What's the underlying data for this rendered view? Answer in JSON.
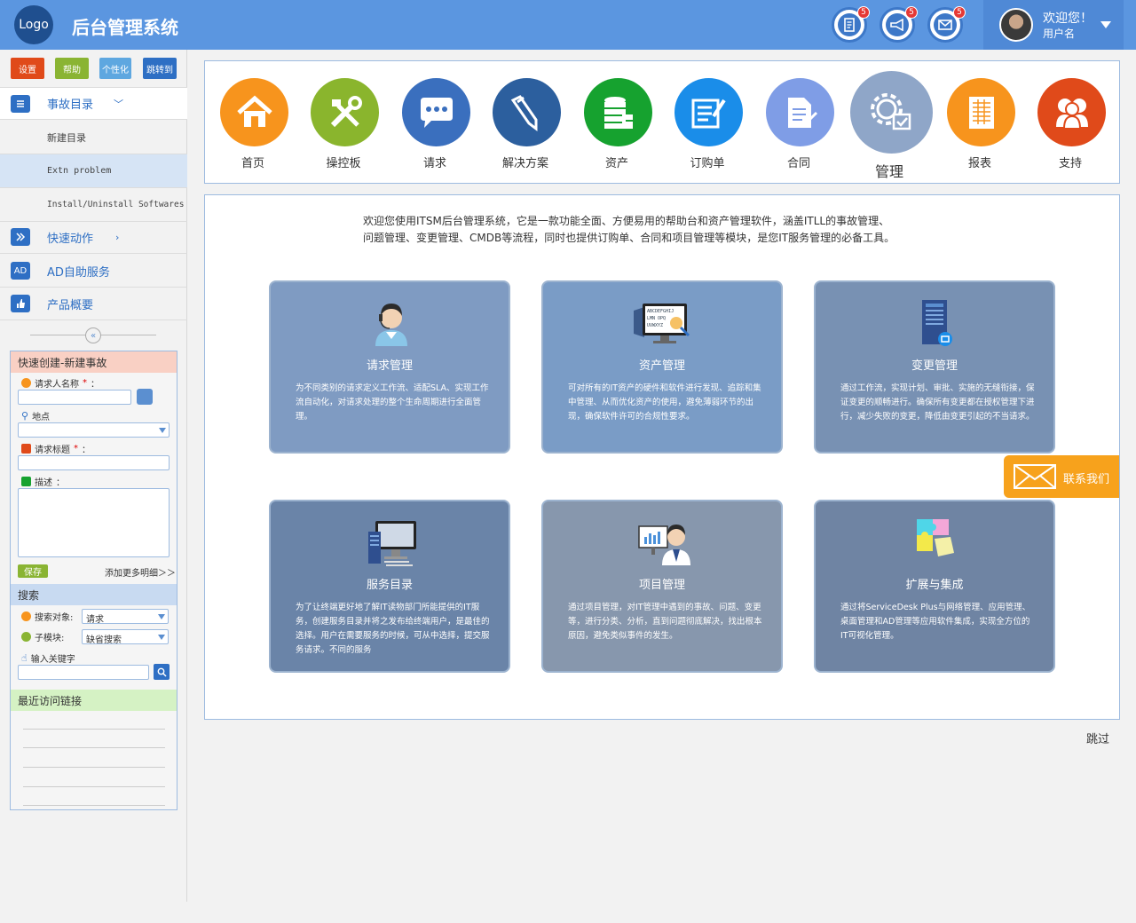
{
  "header": {
    "logo": "Logo",
    "title": "后台管理系统",
    "icons": [
      {
        "name": "document",
        "badge": "5"
      },
      {
        "name": "megaphone",
        "badge": "5"
      },
      {
        "name": "mail",
        "badge": "5"
      }
    ],
    "welcome": "欢迎您！",
    "username": "用户名"
  },
  "sidebar": {
    "quick_buttons": [
      {
        "label": "设置",
        "color": "#e04a1a"
      },
      {
        "label": "帮助",
        "color": "#8ab433"
      },
      {
        "label": "个性化",
        "color": "#5ea7e0"
      },
      {
        "label": "跳转到",
        "color": "#2e6fc4"
      }
    ],
    "incident_catalog": "事故目录",
    "sub_items": [
      "新建目录",
      "Extn problem",
      "Install/Uninstall Softwares"
    ],
    "quick_actions": "快速动作",
    "ad_icon": "AD",
    "ad_service": "AD自助服务",
    "product_overview": "产品概要",
    "quick_create": {
      "title": "快速创建-新建事故",
      "requester_label": "请求人名称",
      "location_label": "地点",
      "subject_label": "请求标题",
      "description_label": "描述",
      "required_mark": "*",
      "colon": "：",
      "save": "保存",
      "more": "添加更多明细＞＞"
    },
    "search": {
      "title": "搜索",
      "object_label": "搜索对象:",
      "object_value": "请求",
      "module_label": "子模块:",
      "module_value": "缺省搜索",
      "keyword_label": "输入关键字"
    },
    "recent": {
      "title": "最近访问链接"
    }
  },
  "topnav": [
    {
      "label": "首页",
      "color": "#f7941d"
    },
    {
      "label": "操控板",
      "color": "#8ab52d"
    },
    {
      "label": "请求",
      "color": "#3a6fbe"
    },
    {
      "label": "解决方案",
      "color": "#2c5f9e"
    },
    {
      "label": "资产",
      "color": "#16a22f"
    },
    {
      "label": "订购单",
      "color": "#1a8de9"
    },
    {
      "label": "合同",
      "color": "#7f9de6"
    },
    {
      "label": "管理",
      "color": "#8fa6c8",
      "active": true
    },
    {
      "label": "报表",
      "color": "#f7941d"
    },
    {
      "label": "支持",
      "color": "#e04a1a"
    }
  ],
  "main": {
    "intro_line1": "欢迎您使用ITSM后台管理系统，它是一款功能全面、方便易用的帮助台和资产管理软件，涵盖ITLL的事故管理、",
    "intro_line2": "问题管理、变更管理、CMDB等流程，同时也提供订购单、合同和项目管理等模块，是您IT服务管理的必备工具。",
    "cards": [
      {
        "title": "请求管理",
        "desc": "为不同类别的请求定义工作流、适配SLA、实现工作流自动化，对请求处理的整个生命周期进行全面管理。",
        "color": "#7f9bc2"
      },
      {
        "title": "资产管理",
        "desc": "可对所有的IT资产的硬件和软件进行发现、追踪和集中管理、从而优化资产的使用，避免薄弱环节的出现，确保软件许可的合规性要求。",
        "color": "#7a9cc6"
      },
      {
        "title": "变更管理",
        "desc": "通过工作流，实现计划、审批、实施的无缝衔接，保证变更的顺畅进行。确保所有变更都在授权管理下进行，减少失败的变更，降低由变更引起的不当请求。",
        "color": "#7891b3"
      },
      {
        "title": "服务目录",
        "desc": "为了让终端更好地了解IT读物部门所能提供的IT服务，创建服务目录并将之发布给终端用户，是最佳的选择。用户在需要服务的时候，可从中选择，提交服务请求。不同的服务",
        "color": "#6a84a8"
      },
      {
        "title": "项目管理",
        "desc": "通过项目管理，对IT管理中遇到的事故、问题、变更等，进行分类、分析，直到问题彻底解决，找出根本原因，避免类似事件的发生。",
        "color": "#8797ad"
      },
      {
        "title": "扩展与集成",
        "desc": "通过将ServiceDesk Plus与网络管理、应用管理、桌面管理和AD管理等应用软件集成，实现全方位的IT可视化管理。",
        "color": "#6f84a3"
      }
    ],
    "contact": "联系我们",
    "skip": "跳过"
  }
}
